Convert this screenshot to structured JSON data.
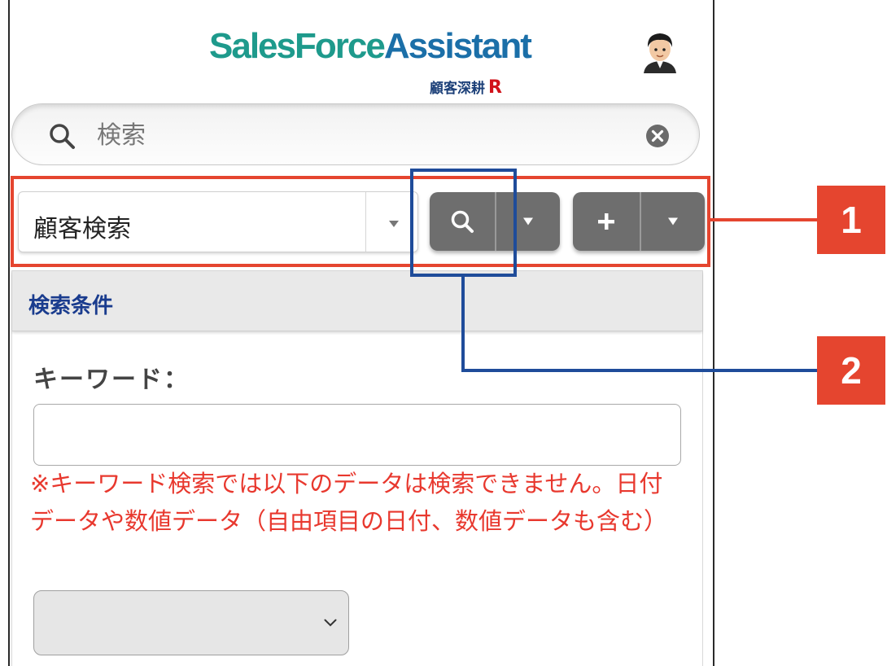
{
  "header": {
    "logo_part1": "Sales",
    "logo_part2": "Force",
    "logo_part3": "Assistant",
    "logo_sub": "顧客深耕",
    "logo_sub_r": "R"
  },
  "search": {
    "placeholder": "検索",
    "value": ""
  },
  "toolbar": {
    "select_value": "顧客検索",
    "search_button_icon": "search-icon",
    "add_button_label": "+",
    "dropdown_icon": "chevron-down-icon"
  },
  "panel": {
    "title": "検索条件",
    "keyword_label": "キーワード：",
    "keyword_value": "",
    "note": "※キーワード検索では以下のデータは検索できません。日付データや数値データ（自由項目の日付、数値データも含む）",
    "dropdown_value": ""
  },
  "annotations": {
    "badge1": "1",
    "badge2": "2"
  },
  "colors": {
    "annotation_red": "#e5452f",
    "annotation_blue": "#1f4c9a",
    "button_gray": "#6e6e6e",
    "title_blue": "#1a3c8e",
    "note_red": "#e8382e",
    "logo_teal": "#1e9a8c",
    "logo_blue": "#1b6fa8"
  }
}
